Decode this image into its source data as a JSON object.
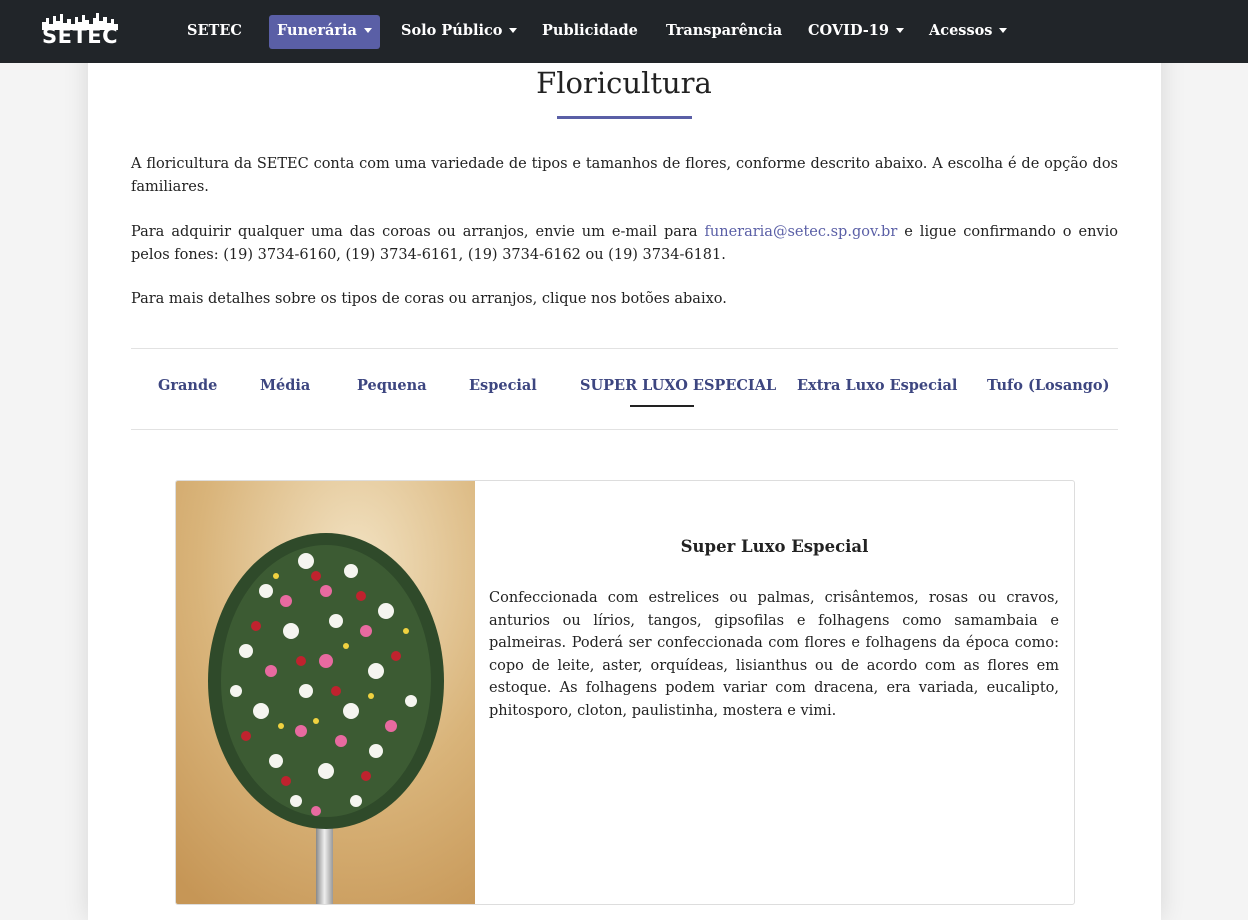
{
  "header": {
    "logo_text": "SETEC",
    "nav": [
      {
        "label": "SETEC"
      },
      {
        "label": "Funerária"
      },
      {
        "label": "Solo Público"
      },
      {
        "label": "Publicidade"
      },
      {
        "label": "Transparência"
      },
      {
        "label": "COVID-19"
      },
      {
        "label": "Acessos"
      }
    ]
  },
  "page": {
    "title": "Floricultura",
    "intro": "A floricultura da SETEC conta com uma variedade de tipos e tamanhos de flores, conforme descrito abaixo. A escolha é de opção dos familiares.",
    "contact_before": "Para adquirir qualquer uma das coroas ou arranjos, envie um e-mail para ",
    "contact_email": "funeraria@setec.sp.gov.br",
    "contact_after": " e ligue confirmando o envio pelos fones: (19) 3734-6160, (19) 3734-6161, (19) 3734-6162 ou (19) 3734-6181.",
    "details": "Para mais detalhes sobre os tipos de coras ou arranjos, clique nos botões abaixo."
  },
  "tabs": [
    {
      "label": "Grande"
    },
    {
      "label": "Média"
    },
    {
      "label": "Pequena"
    },
    {
      "label": "Especial"
    },
    {
      "label": "SUPER LUXO ESPECIAL"
    },
    {
      "label": "Extra Luxo Especial"
    },
    {
      "label": "Tufo (Losango)"
    }
  ],
  "product": {
    "title": "Super Luxo Especial",
    "description": "Confeccionada com estrelices ou palmas, crisântemos, rosas ou cravos, anturios ou lírios, tangos, gipsofilas e folhagens como samambaia e palmeiras. Poderá ser confeccionada com flores e folhagens da época como: copo de leite, aster, orquídeas, lisianthus ou de acordo com as flores em estoque. As folhagens podem variar com dracena, era variada, eucalipto, phitosporo, cloton, paulistinha, mostera e vimi."
  },
  "colors": {
    "navbar": "#212529",
    "accent": "#5a5fa6",
    "tab_text": "#3d4680"
  }
}
